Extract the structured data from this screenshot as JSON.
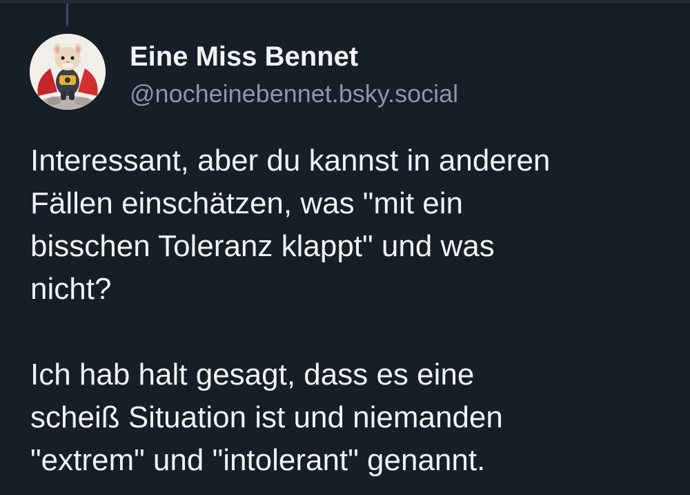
{
  "post": {
    "author": {
      "display_name": "Eine Miss Bennet",
      "handle": "@nocheinebennet.bsky.social",
      "avatar_icon": "hamster-superhero-avatar"
    },
    "paragraphs": [
      [
        "Interessant, aber du kannst in anderen",
        "Fällen einschätzen, was \"mit ein",
        "bisschen Toleranz klappt\" und was",
        "nicht?"
      ],
      [
        "Ich hab halt gesagt, dass es eine",
        "scheiß Situation ist und niemanden",
        "\"extrem\" und \"intolerant\" genannt."
      ]
    ]
  },
  "colors": {
    "background": "#161e27",
    "text_primary": "#f1f3f5",
    "text_secondary": "#8b98a8",
    "thread_line": "#3d4b5c"
  }
}
